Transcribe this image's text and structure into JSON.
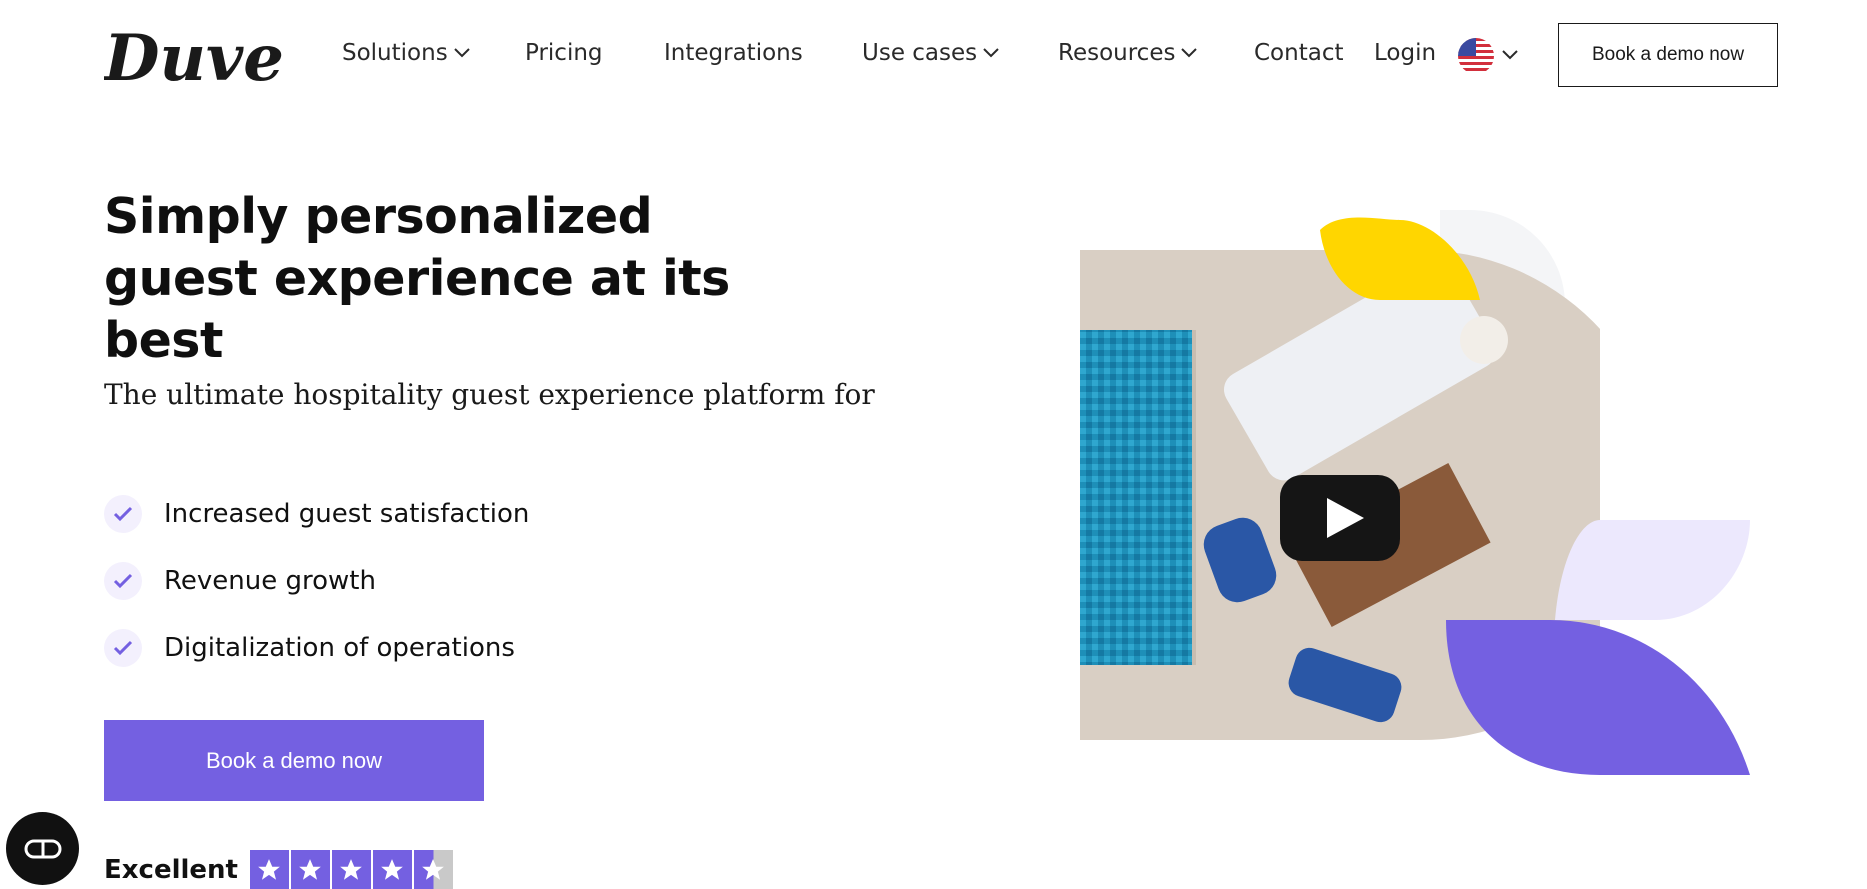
{
  "brand": {
    "logo_text": "Duve",
    "accent": "#7460e1",
    "accent_light": "#ece8fd",
    "yellow": "#ffd600"
  },
  "nav": {
    "items": [
      {
        "label": "Solutions",
        "has_dropdown": true
      },
      {
        "label": "Pricing",
        "has_dropdown": false
      },
      {
        "label": "Integrations",
        "has_dropdown": false
      },
      {
        "label": "Use cases",
        "has_dropdown": true
      },
      {
        "label": "Resources",
        "has_dropdown": true
      },
      {
        "label": "Contact",
        "has_dropdown": false
      }
    ],
    "login_label": "Login",
    "language_icon": "us-flag-icon",
    "demo_button_label": "Book a demo now"
  },
  "hero": {
    "title": "Simply personalized guest experience at its best",
    "subtitle": "The ultimate hospitality guest experience platform for",
    "features": [
      "Increased guest satisfaction",
      "Revenue growth",
      "Digitalization of operations"
    ],
    "cta_label": "Book a demo now",
    "rating": {
      "label": "Excellent",
      "stars": 4.5
    },
    "video": {
      "play_icon": "play-icon"
    }
  },
  "chat_widget": {
    "icon": "chat-icon"
  }
}
